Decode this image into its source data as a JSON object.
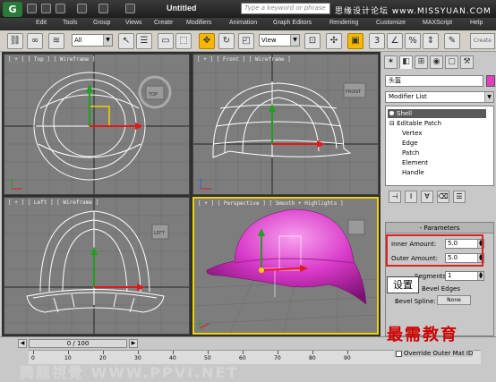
{
  "titlebar": {
    "app_letter": "G",
    "title": "Untitled",
    "search_placeholder": "Type a keyword or phrase",
    "watermark": "思缘设计论坛 www.MISSYUAN.COM"
  },
  "menu": [
    "Edit",
    "Tools",
    "Group",
    "Views",
    "Create",
    "Modifiers",
    "Animation",
    "Graph Editors",
    "Rendering",
    "Customize",
    "MAXScript",
    "Help"
  ],
  "toolbar": {
    "selection_filter": "All",
    "ref_coord": "View",
    "create_selection_set": "Create Selection"
  },
  "viewports": {
    "top": {
      "label": "[ + ] [ Top ] [ Wireframe ]",
      "cube": "TOP"
    },
    "front": {
      "label": "[ + ] [ Front ] [ Wireframe ]",
      "cube": "FRONT"
    },
    "left": {
      "label": "[ + ] [ Left ] [ Wireframe ]",
      "cube": "LEFT"
    },
    "perspective": {
      "label": "[ + ] [ Perspective ] [ Smooth + Highlights ]"
    }
  },
  "command_panel": {
    "object_name": "头盔",
    "modifier_list": "Modifier List",
    "stack": [
      "Shell",
      "Editable Patch",
      "Vertex",
      "Edge",
      "Patch",
      "Element",
      "Handle"
    ],
    "rollout_title": "Parameters",
    "inner_amount_label": "Inner Amount:",
    "inner_amount": "5.0",
    "outer_amount_label": "Outer Amount:",
    "outer_amount": "5.0",
    "segments_label": "Segments:",
    "segments": "1",
    "bevel_edges_label": "Bevel Edges",
    "bevel_spline_label": "Bevel Spline:",
    "bevel_spline_value": "None",
    "override_outer_label": "Override Outer Mat ID"
  },
  "tooltip": "设置",
  "timeline": {
    "slider": "0 / 100",
    "ticks": [
      "0",
      "10",
      "20",
      "30",
      "40",
      "50",
      "60",
      "70",
      "80",
      "90"
    ]
  },
  "watermarks": {
    "center": "腾龍視覺 WWW.PPVI.NET",
    "corner": "最需教育"
  },
  "colors": {
    "accent": "#f5b800",
    "highlight": "#e02020",
    "object": "#e040c0"
  }
}
